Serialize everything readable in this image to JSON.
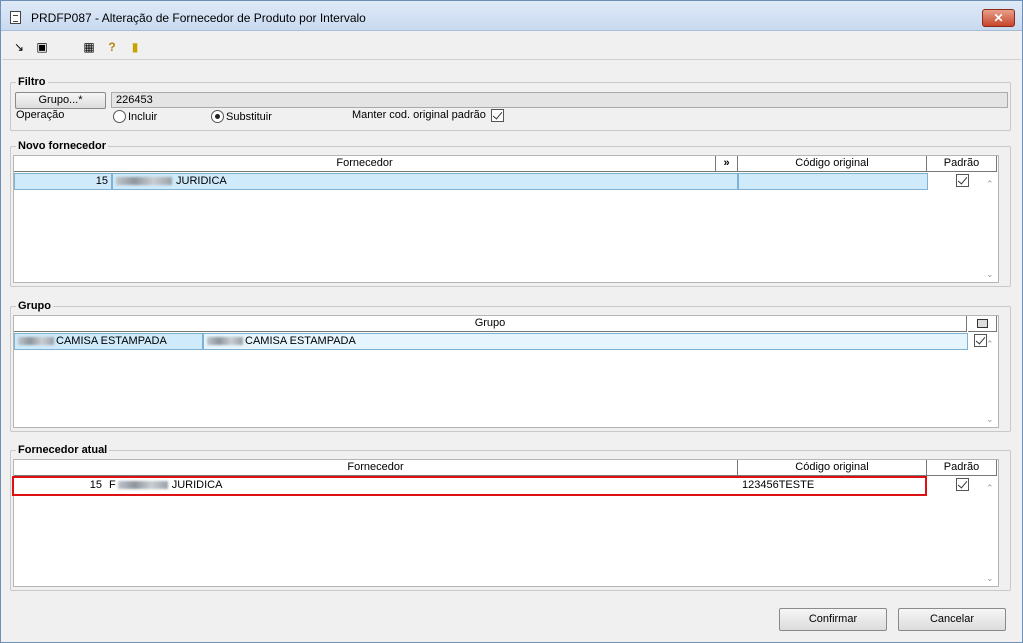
{
  "window": {
    "title": "PRDFP087 - Alteração de Fornecedor de Produto por Intervalo",
    "close": "✕"
  },
  "toolbar": {
    "icons": [
      "arrow-in-icon",
      "copy-icon",
      "calendar-icon",
      "help-icon",
      "exit-door-icon"
    ]
  },
  "filtro": {
    "legend": "Filtro",
    "grupo_button": "Grupo...*",
    "grupo_value": "226453",
    "operacao_label": "Operação",
    "incluir_label": "Incluir",
    "substituir_label": "Substituir",
    "selected": "Substituir",
    "manter_label": "Manter cod. original padrão",
    "manter_checked": true
  },
  "novo_fornecedor": {
    "legend": "Novo fornecedor",
    "columns": [
      "Fornecedor",
      "»",
      "Código original",
      "Padrão"
    ],
    "rows": [
      {
        "codigo": "15",
        "nome": "JURIDICA",
        "codigo_original": "",
        "padrao": true
      }
    ]
  },
  "grupo": {
    "legend": "Grupo",
    "columns": [
      "Grupo"
    ],
    "rows": [
      {
        "col1": "CAMISA ESTAMPADA",
        "col2": "CAMISA ESTAMPADA",
        "checked": true
      }
    ]
  },
  "fornecedor_atual": {
    "legend": "Fornecedor atual",
    "columns": [
      "Fornecedor",
      "Código original",
      "Padrão"
    ],
    "rows": [
      {
        "codigo": "15",
        "prefix": "F",
        "nome": "JURIDICA",
        "codigo_original": "123456TESTE",
        "padrao": true
      }
    ]
  },
  "footer": {
    "confirmar": "Confirmar",
    "cancelar": "Cancelar"
  },
  "colors": {
    "selection": "#cfeafa",
    "highlight": "#dd1111"
  }
}
